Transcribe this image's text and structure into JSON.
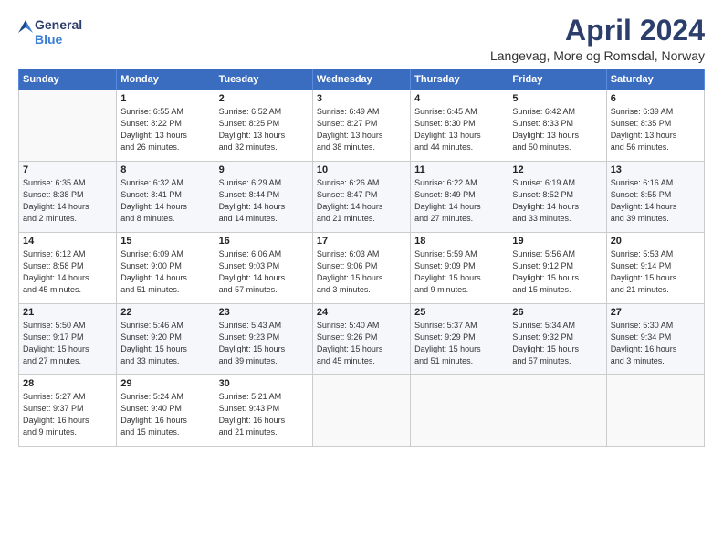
{
  "header": {
    "logo_line1": "General",
    "logo_line2": "Blue",
    "month_title": "April 2024",
    "location": "Langevag, More og Romsdal, Norway"
  },
  "weekdays": [
    "Sunday",
    "Monday",
    "Tuesday",
    "Wednesday",
    "Thursday",
    "Friday",
    "Saturday"
  ],
  "weeks": [
    [
      {
        "day": "",
        "info": ""
      },
      {
        "day": "1",
        "info": "Sunrise: 6:55 AM\nSunset: 8:22 PM\nDaylight: 13 hours\nand 26 minutes."
      },
      {
        "day": "2",
        "info": "Sunrise: 6:52 AM\nSunset: 8:25 PM\nDaylight: 13 hours\nand 32 minutes."
      },
      {
        "day": "3",
        "info": "Sunrise: 6:49 AM\nSunset: 8:27 PM\nDaylight: 13 hours\nand 38 minutes."
      },
      {
        "day": "4",
        "info": "Sunrise: 6:45 AM\nSunset: 8:30 PM\nDaylight: 13 hours\nand 44 minutes."
      },
      {
        "day": "5",
        "info": "Sunrise: 6:42 AM\nSunset: 8:33 PM\nDaylight: 13 hours\nand 50 minutes."
      },
      {
        "day": "6",
        "info": "Sunrise: 6:39 AM\nSunset: 8:35 PM\nDaylight: 13 hours\nand 56 minutes."
      }
    ],
    [
      {
        "day": "7",
        "info": "Sunrise: 6:35 AM\nSunset: 8:38 PM\nDaylight: 14 hours\nand 2 minutes."
      },
      {
        "day": "8",
        "info": "Sunrise: 6:32 AM\nSunset: 8:41 PM\nDaylight: 14 hours\nand 8 minutes."
      },
      {
        "day": "9",
        "info": "Sunrise: 6:29 AM\nSunset: 8:44 PM\nDaylight: 14 hours\nand 14 minutes."
      },
      {
        "day": "10",
        "info": "Sunrise: 6:26 AM\nSunset: 8:47 PM\nDaylight: 14 hours\nand 21 minutes."
      },
      {
        "day": "11",
        "info": "Sunrise: 6:22 AM\nSunset: 8:49 PM\nDaylight: 14 hours\nand 27 minutes."
      },
      {
        "day": "12",
        "info": "Sunrise: 6:19 AM\nSunset: 8:52 PM\nDaylight: 14 hours\nand 33 minutes."
      },
      {
        "day": "13",
        "info": "Sunrise: 6:16 AM\nSunset: 8:55 PM\nDaylight: 14 hours\nand 39 minutes."
      }
    ],
    [
      {
        "day": "14",
        "info": "Sunrise: 6:12 AM\nSunset: 8:58 PM\nDaylight: 14 hours\nand 45 minutes."
      },
      {
        "day": "15",
        "info": "Sunrise: 6:09 AM\nSunset: 9:00 PM\nDaylight: 14 hours\nand 51 minutes."
      },
      {
        "day": "16",
        "info": "Sunrise: 6:06 AM\nSunset: 9:03 PM\nDaylight: 14 hours\nand 57 minutes."
      },
      {
        "day": "17",
        "info": "Sunrise: 6:03 AM\nSunset: 9:06 PM\nDaylight: 15 hours\nand 3 minutes."
      },
      {
        "day": "18",
        "info": "Sunrise: 5:59 AM\nSunset: 9:09 PM\nDaylight: 15 hours\nand 9 minutes."
      },
      {
        "day": "19",
        "info": "Sunrise: 5:56 AM\nSunset: 9:12 PM\nDaylight: 15 hours\nand 15 minutes."
      },
      {
        "day": "20",
        "info": "Sunrise: 5:53 AM\nSunset: 9:14 PM\nDaylight: 15 hours\nand 21 minutes."
      }
    ],
    [
      {
        "day": "21",
        "info": "Sunrise: 5:50 AM\nSunset: 9:17 PM\nDaylight: 15 hours\nand 27 minutes."
      },
      {
        "day": "22",
        "info": "Sunrise: 5:46 AM\nSunset: 9:20 PM\nDaylight: 15 hours\nand 33 minutes."
      },
      {
        "day": "23",
        "info": "Sunrise: 5:43 AM\nSunset: 9:23 PM\nDaylight: 15 hours\nand 39 minutes."
      },
      {
        "day": "24",
        "info": "Sunrise: 5:40 AM\nSunset: 9:26 PM\nDaylight: 15 hours\nand 45 minutes."
      },
      {
        "day": "25",
        "info": "Sunrise: 5:37 AM\nSunset: 9:29 PM\nDaylight: 15 hours\nand 51 minutes."
      },
      {
        "day": "26",
        "info": "Sunrise: 5:34 AM\nSunset: 9:32 PM\nDaylight: 15 hours\nand 57 minutes."
      },
      {
        "day": "27",
        "info": "Sunrise: 5:30 AM\nSunset: 9:34 PM\nDaylight: 16 hours\nand 3 minutes."
      }
    ],
    [
      {
        "day": "28",
        "info": "Sunrise: 5:27 AM\nSunset: 9:37 PM\nDaylight: 16 hours\nand 9 minutes."
      },
      {
        "day": "29",
        "info": "Sunrise: 5:24 AM\nSunset: 9:40 PM\nDaylight: 16 hours\nand 15 minutes."
      },
      {
        "day": "30",
        "info": "Sunrise: 5:21 AM\nSunset: 9:43 PM\nDaylight: 16 hours\nand 21 minutes."
      },
      {
        "day": "",
        "info": ""
      },
      {
        "day": "",
        "info": ""
      },
      {
        "day": "",
        "info": ""
      },
      {
        "day": "",
        "info": ""
      }
    ]
  ]
}
